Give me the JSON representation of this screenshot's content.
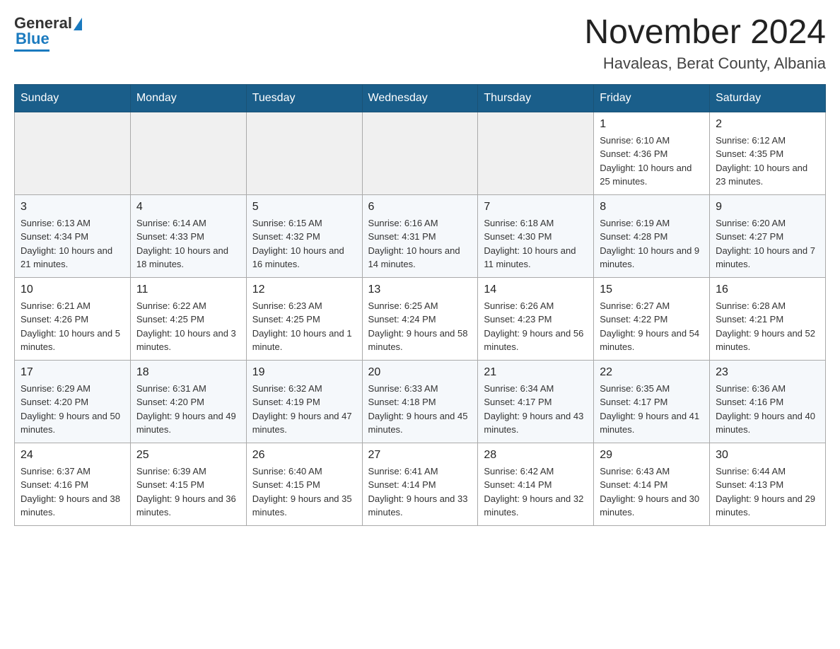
{
  "logo": {
    "general": "General",
    "blue": "Blue"
  },
  "title": "November 2024",
  "location": "Havaleas, Berat County, Albania",
  "days_of_week": [
    "Sunday",
    "Monday",
    "Tuesday",
    "Wednesday",
    "Thursday",
    "Friday",
    "Saturday"
  ],
  "weeks": [
    [
      {
        "day": "",
        "sunrise": "",
        "sunset": "",
        "daylight": ""
      },
      {
        "day": "",
        "sunrise": "",
        "sunset": "",
        "daylight": ""
      },
      {
        "day": "",
        "sunrise": "",
        "sunset": "",
        "daylight": ""
      },
      {
        "day": "",
        "sunrise": "",
        "sunset": "",
        "daylight": ""
      },
      {
        "day": "",
        "sunrise": "",
        "sunset": "",
        "daylight": ""
      },
      {
        "day": "1",
        "sunrise": "Sunrise: 6:10 AM",
        "sunset": "Sunset: 4:36 PM",
        "daylight": "Daylight: 10 hours and 25 minutes."
      },
      {
        "day": "2",
        "sunrise": "Sunrise: 6:12 AM",
        "sunset": "Sunset: 4:35 PM",
        "daylight": "Daylight: 10 hours and 23 minutes."
      }
    ],
    [
      {
        "day": "3",
        "sunrise": "Sunrise: 6:13 AM",
        "sunset": "Sunset: 4:34 PM",
        "daylight": "Daylight: 10 hours and 21 minutes."
      },
      {
        "day": "4",
        "sunrise": "Sunrise: 6:14 AM",
        "sunset": "Sunset: 4:33 PM",
        "daylight": "Daylight: 10 hours and 18 minutes."
      },
      {
        "day": "5",
        "sunrise": "Sunrise: 6:15 AM",
        "sunset": "Sunset: 4:32 PM",
        "daylight": "Daylight: 10 hours and 16 minutes."
      },
      {
        "day": "6",
        "sunrise": "Sunrise: 6:16 AM",
        "sunset": "Sunset: 4:31 PM",
        "daylight": "Daylight: 10 hours and 14 minutes."
      },
      {
        "day": "7",
        "sunrise": "Sunrise: 6:18 AM",
        "sunset": "Sunset: 4:30 PM",
        "daylight": "Daylight: 10 hours and 11 minutes."
      },
      {
        "day": "8",
        "sunrise": "Sunrise: 6:19 AM",
        "sunset": "Sunset: 4:28 PM",
        "daylight": "Daylight: 10 hours and 9 minutes."
      },
      {
        "day": "9",
        "sunrise": "Sunrise: 6:20 AM",
        "sunset": "Sunset: 4:27 PM",
        "daylight": "Daylight: 10 hours and 7 minutes."
      }
    ],
    [
      {
        "day": "10",
        "sunrise": "Sunrise: 6:21 AM",
        "sunset": "Sunset: 4:26 PM",
        "daylight": "Daylight: 10 hours and 5 minutes."
      },
      {
        "day": "11",
        "sunrise": "Sunrise: 6:22 AM",
        "sunset": "Sunset: 4:25 PM",
        "daylight": "Daylight: 10 hours and 3 minutes."
      },
      {
        "day": "12",
        "sunrise": "Sunrise: 6:23 AM",
        "sunset": "Sunset: 4:25 PM",
        "daylight": "Daylight: 10 hours and 1 minute."
      },
      {
        "day": "13",
        "sunrise": "Sunrise: 6:25 AM",
        "sunset": "Sunset: 4:24 PM",
        "daylight": "Daylight: 9 hours and 58 minutes."
      },
      {
        "day": "14",
        "sunrise": "Sunrise: 6:26 AM",
        "sunset": "Sunset: 4:23 PM",
        "daylight": "Daylight: 9 hours and 56 minutes."
      },
      {
        "day": "15",
        "sunrise": "Sunrise: 6:27 AM",
        "sunset": "Sunset: 4:22 PM",
        "daylight": "Daylight: 9 hours and 54 minutes."
      },
      {
        "day": "16",
        "sunrise": "Sunrise: 6:28 AM",
        "sunset": "Sunset: 4:21 PM",
        "daylight": "Daylight: 9 hours and 52 minutes."
      }
    ],
    [
      {
        "day": "17",
        "sunrise": "Sunrise: 6:29 AM",
        "sunset": "Sunset: 4:20 PM",
        "daylight": "Daylight: 9 hours and 50 minutes."
      },
      {
        "day": "18",
        "sunrise": "Sunrise: 6:31 AM",
        "sunset": "Sunset: 4:20 PM",
        "daylight": "Daylight: 9 hours and 49 minutes."
      },
      {
        "day": "19",
        "sunrise": "Sunrise: 6:32 AM",
        "sunset": "Sunset: 4:19 PM",
        "daylight": "Daylight: 9 hours and 47 minutes."
      },
      {
        "day": "20",
        "sunrise": "Sunrise: 6:33 AM",
        "sunset": "Sunset: 4:18 PM",
        "daylight": "Daylight: 9 hours and 45 minutes."
      },
      {
        "day": "21",
        "sunrise": "Sunrise: 6:34 AM",
        "sunset": "Sunset: 4:17 PM",
        "daylight": "Daylight: 9 hours and 43 minutes."
      },
      {
        "day": "22",
        "sunrise": "Sunrise: 6:35 AM",
        "sunset": "Sunset: 4:17 PM",
        "daylight": "Daylight: 9 hours and 41 minutes."
      },
      {
        "day": "23",
        "sunrise": "Sunrise: 6:36 AM",
        "sunset": "Sunset: 4:16 PM",
        "daylight": "Daylight: 9 hours and 40 minutes."
      }
    ],
    [
      {
        "day": "24",
        "sunrise": "Sunrise: 6:37 AM",
        "sunset": "Sunset: 4:16 PM",
        "daylight": "Daylight: 9 hours and 38 minutes."
      },
      {
        "day": "25",
        "sunrise": "Sunrise: 6:39 AM",
        "sunset": "Sunset: 4:15 PM",
        "daylight": "Daylight: 9 hours and 36 minutes."
      },
      {
        "day": "26",
        "sunrise": "Sunrise: 6:40 AM",
        "sunset": "Sunset: 4:15 PM",
        "daylight": "Daylight: 9 hours and 35 minutes."
      },
      {
        "day": "27",
        "sunrise": "Sunrise: 6:41 AM",
        "sunset": "Sunset: 4:14 PM",
        "daylight": "Daylight: 9 hours and 33 minutes."
      },
      {
        "day": "28",
        "sunrise": "Sunrise: 6:42 AM",
        "sunset": "Sunset: 4:14 PM",
        "daylight": "Daylight: 9 hours and 32 minutes."
      },
      {
        "day": "29",
        "sunrise": "Sunrise: 6:43 AM",
        "sunset": "Sunset: 4:14 PM",
        "daylight": "Daylight: 9 hours and 30 minutes."
      },
      {
        "day": "30",
        "sunrise": "Sunrise: 6:44 AM",
        "sunset": "Sunset: 4:13 PM",
        "daylight": "Daylight: 9 hours and 29 minutes."
      }
    ]
  ]
}
